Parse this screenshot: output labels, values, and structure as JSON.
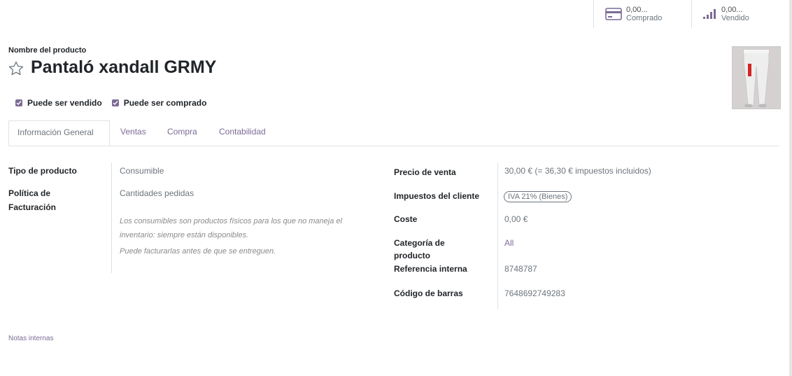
{
  "smart_buttons": {
    "purchased": {
      "value": "0,00...",
      "label": "Comprado",
      "icon": "credit-card-icon"
    },
    "sold": {
      "value": "0,00...",
      "label": "Vendido",
      "icon": "signal-bars-icon"
    }
  },
  "product": {
    "name_label": "Nombre del producto",
    "name": "Pantaló xandall GRMY",
    "favorite_icon": "star-outline-icon"
  },
  "checkboxes": [
    {
      "label": "Puede ser vendido",
      "checked": true
    },
    {
      "label": "Puede ser comprado",
      "checked": true
    }
  ],
  "tabs": [
    {
      "label": "Información General",
      "active": true
    },
    {
      "label": "Ventas",
      "active": false
    },
    {
      "label": "Compra",
      "active": false
    },
    {
      "label": "Contabilidad",
      "active": false
    }
  ],
  "general": {
    "product_type": {
      "label": "Tipo de producto",
      "value": "Consumible"
    },
    "invoice_policy": {
      "label_line1": "Política de",
      "label_line2": "Facturación",
      "value": "Cantidades pedidas"
    },
    "help": [
      "Los consumibles son productos físicos para los que no maneja el inventario: siempre están disponibles.",
      "Puede facturarlas antes de que se entreguen."
    ],
    "sale_price": {
      "label": "Precio de venta",
      "value": "30,00 €  (= 36,30 € impuestos incluidos)"
    },
    "customer_taxes": {
      "label": "Impuestos del cliente",
      "value": "IVA 21% (Bienes)"
    },
    "cost": {
      "label": "Coste",
      "value": "0,00 €"
    },
    "category": {
      "label_line1": "Categoría de",
      "label_line2": "producto",
      "value": "All"
    },
    "internal_ref": {
      "label": "Referencia interna",
      "value": "8748787"
    },
    "barcode": {
      "label": "Código de barras",
      "value": "7648692749283"
    }
  },
  "notes_label": "Notas internas",
  "colors": {
    "accent": "#7c6b95",
    "muted": "#6c757d",
    "text": "#212529",
    "border": "#dee2e6"
  }
}
